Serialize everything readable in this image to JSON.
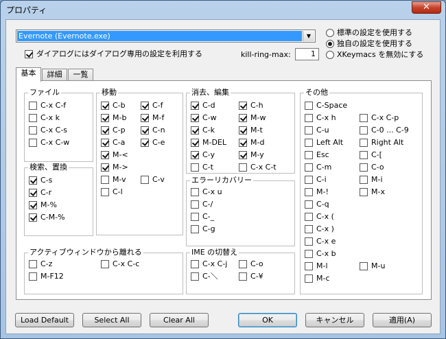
{
  "window": {
    "title": "プロパティ",
    "close": "✕"
  },
  "target": {
    "value": "Evernote (Evernote.exe)"
  },
  "settings_mode": {
    "options": [
      {
        "label": "標準の設定を使用する",
        "selected": false
      },
      {
        "label": "独自の設定を使用する",
        "selected": true
      },
      {
        "label": "XKeymacs を無効にする",
        "selected": false
      }
    ]
  },
  "dialog_option": {
    "label": "ダイアログにはダイアログ専用の設定を利用する",
    "checked": true
  },
  "kill_ring": {
    "label": "kill-ring-max:",
    "value": "1"
  },
  "tabs": [
    {
      "label": "基本",
      "active": true
    },
    {
      "label": "詳細",
      "active": false
    },
    {
      "label": "一覧",
      "active": false
    }
  ],
  "groups": {
    "file": {
      "label": "ファイル",
      "items": [
        {
          "label": "C-x C-f",
          "checked": false
        },
        {
          "label": "C-x k",
          "checked": false
        },
        {
          "label": "C-x C-s",
          "checked": false
        },
        {
          "label": "C-x C-w",
          "checked": false
        }
      ]
    },
    "search": {
      "label": "検索、置換",
      "items": [
        {
          "label": "C-s",
          "checked": true
        },
        {
          "label": "C-r",
          "checked": true
        },
        {
          "label": "M-%",
          "checked": true
        },
        {
          "label": "C-M-%",
          "checked": true
        }
      ]
    },
    "move": {
      "label": "移動",
      "items": [
        {
          "label": "C-b",
          "checked": true
        },
        {
          "label": "C-f",
          "checked": true
        },
        {
          "label": "M-b",
          "checked": true
        },
        {
          "label": "M-f",
          "checked": true
        },
        {
          "label": "C-p",
          "checked": true
        },
        {
          "label": "C-n",
          "checked": true
        },
        {
          "label": "C-a",
          "checked": true
        },
        {
          "label": "C-e",
          "checked": true
        },
        {
          "label": "M-<",
          "checked": true
        },
        {
          "label": "M->",
          "checked": true
        },
        {
          "label": "M-v",
          "checked": false
        },
        {
          "label": "C-v",
          "checked": false
        },
        {
          "label": "C-l",
          "checked": false
        }
      ]
    },
    "edit": {
      "label": "消去、編集",
      "items": [
        {
          "label": "C-d",
          "checked": true
        },
        {
          "label": "C-h",
          "checked": true
        },
        {
          "label": "C-w",
          "checked": true
        },
        {
          "label": "M-w",
          "checked": true
        },
        {
          "label": "C-k",
          "checked": true
        },
        {
          "label": "M-t",
          "checked": true
        },
        {
          "label": "M-DEL",
          "checked": true
        },
        {
          "label": "M-d",
          "checked": true
        },
        {
          "label": "C-y",
          "checked": true
        },
        {
          "label": "M-y",
          "checked": true
        },
        {
          "label": "C-t",
          "checked": false
        },
        {
          "label": "C-x C-t",
          "checked": false
        }
      ]
    },
    "error": {
      "label": "エラーリカバリー",
      "items": [
        {
          "label": "C-x u",
          "checked": false
        },
        {
          "label": "C-/",
          "checked": false
        },
        {
          "label": "C-_",
          "checked": false
        },
        {
          "label": "C-g",
          "checked": false
        }
      ]
    },
    "ime": {
      "label": "IME の切替え",
      "items": [
        {
          "label": "C-x C-j",
          "checked": false
        },
        {
          "label": "C-o",
          "checked": false
        },
        {
          "label": "C-＼",
          "checked": false
        },
        {
          "label": "C-¥",
          "checked": false
        }
      ]
    },
    "active": {
      "label": "アクティブウィンドウから離れる",
      "items": [
        {
          "label": "C-z",
          "checked": false
        },
        {
          "label": "C-x C-c",
          "checked": false
        },
        {
          "label": "M-F12",
          "checked": false
        }
      ]
    },
    "other": {
      "label": "その他",
      "items": [
        {
          "label": "C-Space",
          "checked": false
        },
        {
          "label": "C-x h",
          "checked": false
        },
        {
          "label": "C-x C-p",
          "checked": false
        },
        {
          "label": "C-u",
          "checked": false
        },
        {
          "label": "C-0 ... C-9",
          "checked": false
        },
        {
          "label": "Left Alt",
          "checked": false
        },
        {
          "label": "Right Alt",
          "checked": false
        },
        {
          "label": "Esc",
          "checked": false
        },
        {
          "label": "C-[",
          "checked": false
        },
        {
          "label": "C-m",
          "checked": false
        },
        {
          "label": "C-o",
          "checked": false
        },
        {
          "label": "C-i",
          "checked": false
        },
        {
          "label": "M-i",
          "checked": false
        },
        {
          "label": "M-!",
          "checked": false
        },
        {
          "label": "M-x",
          "checked": false
        },
        {
          "label": "C-q",
          "checked": false
        },
        {
          "label": "C-x (",
          "checked": false
        },
        {
          "label": "C-x )",
          "checked": false
        },
        {
          "label": "C-x e",
          "checked": false
        },
        {
          "label": "C-x b",
          "checked": false
        },
        {
          "label": "M-l",
          "checked": false
        },
        {
          "label": "M-u",
          "checked": false
        },
        {
          "label": "M-c",
          "checked": false
        }
      ]
    }
  },
  "buttons": {
    "load_default": "Load Default",
    "select_all": "Select All",
    "clear_all": "Clear All",
    "ok": "OK",
    "cancel": "キャンセル",
    "apply": "適用(A)"
  }
}
